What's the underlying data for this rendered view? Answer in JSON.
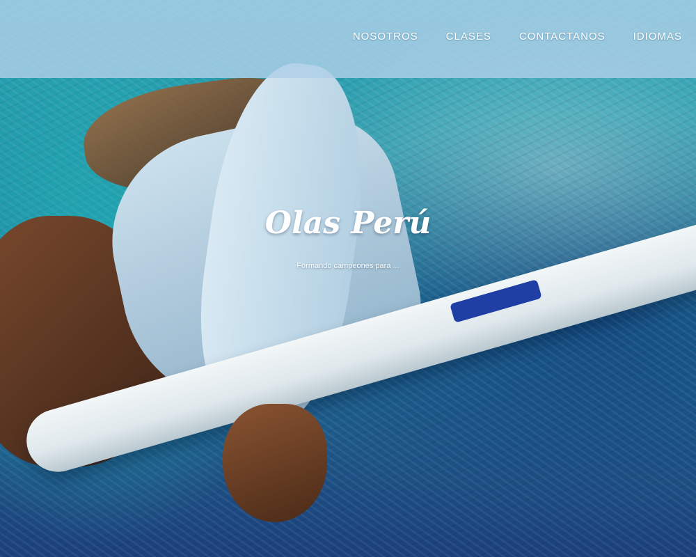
{
  "nav": {
    "items": [
      {
        "label": "NOSOTROS"
      },
      {
        "label": "CLASES"
      },
      {
        "label": "CONTACTANOS"
      },
      {
        "label": "IDIOMAS"
      }
    ]
  },
  "hero": {
    "brand": "Olas Perú",
    "tagline": "Formando campeones para ..."
  },
  "colors": {
    "navbar": "#afd0e8",
    "ocean_teal": "#2aa6b4",
    "ocean_deep": "#1c3f7a",
    "text": "#ffffff"
  }
}
